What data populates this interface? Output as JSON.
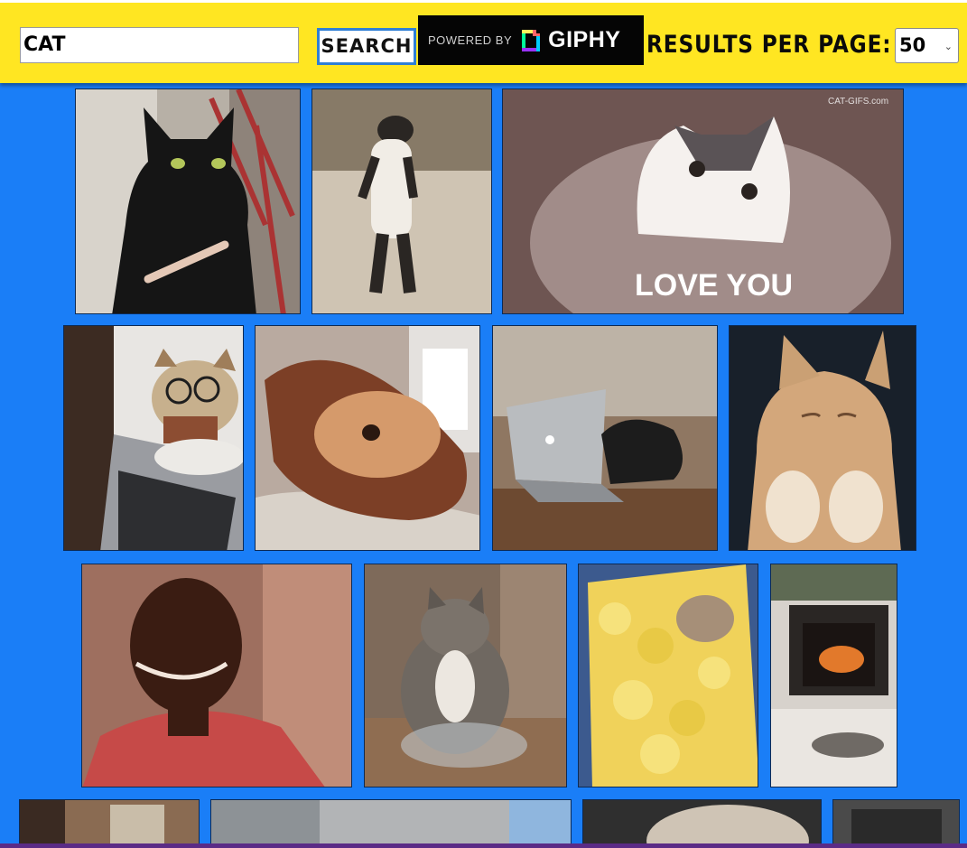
{
  "search": {
    "value": "CAT"
  },
  "buttons": {
    "search_label": "SEARCH"
  },
  "branding": {
    "powered_by": "POWERED BY",
    "giphy": "GIPHY"
  },
  "results_per_page": {
    "label": "RESULTS PER PAGE:",
    "selected": "50"
  },
  "gifs": [
    {
      "name": "black-cat-nail-file"
    },
    {
      "name": "cat-walking-upright"
    },
    {
      "name": "cat-love-you",
      "caption": "LOVE YOU",
      "watermark": "CAT-GIFS.com"
    },
    {
      "name": "cat-glasses-laptop"
    },
    {
      "name": "cat-in-slipper"
    },
    {
      "name": "cat-typing-laptop"
    },
    {
      "name": "kitten-clapping"
    },
    {
      "name": "man-nodding"
    },
    {
      "name": "cat-in-bowl"
    },
    {
      "name": "kitten-in-chicks"
    },
    {
      "name": "cat-by-fireplace"
    },
    {
      "name": "gif-row4-1"
    },
    {
      "name": "gif-row4-2"
    },
    {
      "name": "gif-row4-3"
    },
    {
      "name": "gif-row4-4"
    }
  ],
  "colors": {
    "header": "#ffe622",
    "background": "#1a7ef7",
    "button_border": "#2f7fd6"
  }
}
